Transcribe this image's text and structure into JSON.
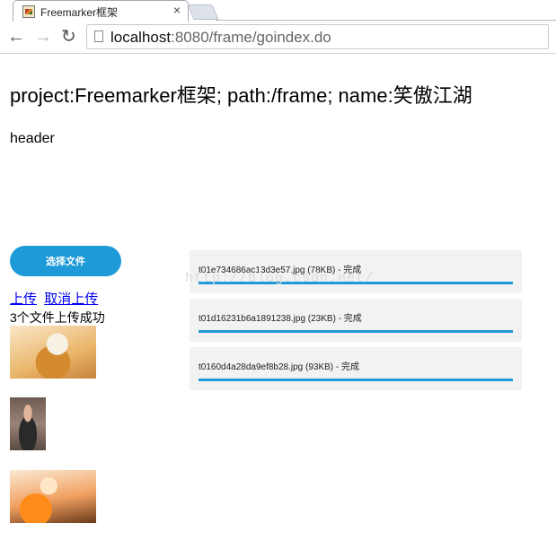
{
  "browser": {
    "tab": {
      "title": "Freemarker框架",
      "close": "×"
    },
    "url": {
      "host": "localhost",
      "rest": ":8080/frame/goindex.do"
    },
    "nav": {
      "back": "←",
      "forward": "→",
      "reload": "↻"
    }
  },
  "page": {
    "title": "project:Freemarker框架; path:/frame; name:笑傲江湖",
    "header": "header",
    "choose_button": "选择文件",
    "upload_link": "上传",
    "cancel_link": "取消上传",
    "success_message": "3个文件上传成功",
    "watermark": "http://blog.csdn.net/",
    "uploads": [
      {
        "label": "t01e734686ac13d3e57.jpg (78KB) - 完成",
        "progress": 1.0
      },
      {
        "label": "t01d16231b6a1891238.jpg (23KB) - 完成",
        "progress": 1.0
      },
      {
        "label": "t0160d4a28da9ef8b28.jpg (93KB) - 完成",
        "progress": 1.0
      }
    ]
  },
  "colors": {
    "accent": "#1e9ad8",
    "link": "#0000ee",
    "item_bg": "#f2f2f2"
  }
}
